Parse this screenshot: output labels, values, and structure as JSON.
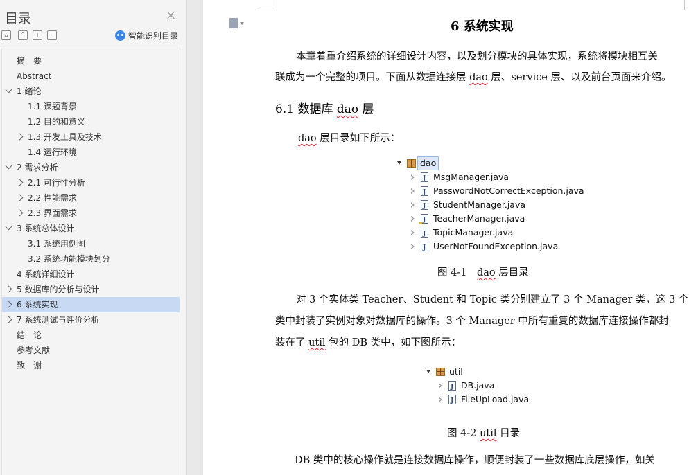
{
  "sidebar": {
    "title": "目录",
    "close_label": "close",
    "tools": [
      "expand-all",
      "collapse-up",
      "expand-plus",
      "collapse-minus"
    ],
    "smart_toc_label": "智能识别目录",
    "toc": [
      {
        "label": "摘　要",
        "level": 0,
        "chevron": "none",
        "active": false
      },
      {
        "label": "Abstract",
        "level": 0,
        "chevron": "none",
        "active": false
      },
      {
        "label": "1 绪论",
        "level": 0,
        "chevron": "down",
        "active": false
      },
      {
        "label": "1.1 课题背景",
        "level": 1,
        "chevron": "none",
        "active": false
      },
      {
        "label": "1.2 目的和意义",
        "level": 1,
        "chevron": "none",
        "active": false
      },
      {
        "label": "1.3 开发工具及技术",
        "level": 1,
        "chevron": "right",
        "active": false
      },
      {
        "label": "1.4 运行环境",
        "level": 1,
        "chevron": "none",
        "active": false
      },
      {
        "label": "2  需求分析",
        "level": 0,
        "chevron": "down",
        "active": false
      },
      {
        "label": "2.1 可行性分析",
        "level": 1,
        "chevron": "right",
        "active": false
      },
      {
        "label": "2.2 性能需求",
        "level": 1,
        "chevron": "right",
        "active": false
      },
      {
        "label": "2.3 界面需求",
        "level": 1,
        "chevron": "right",
        "active": false
      },
      {
        "label": "3  系统总体设计",
        "level": 0,
        "chevron": "down",
        "active": false
      },
      {
        "label": "3.1  系统用例图",
        "level": 1,
        "chevron": "none",
        "active": false
      },
      {
        "label": "3.2  系统功能模块划分",
        "level": 1,
        "chevron": "none",
        "active": false
      },
      {
        "label": "4 系统详细设计",
        "level": 0,
        "chevron": "none",
        "active": false
      },
      {
        "label": "5 数据库的分析与设计",
        "level": 0,
        "chevron": "right",
        "active": false
      },
      {
        "label": "6 系统实现",
        "level": 0,
        "chevron": "right",
        "active": true
      },
      {
        "label": "7 系统测试与评价分析",
        "level": 0,
        "chevron": "right",
        "active": false
      },
      {
        "label": "结　论",
        "level": 0,
        "chevron": "none",
        "active": false
      },
      {
        "label": "参考文献",
        "level": 0,
        "chevron": "none",
        "active": false
      },
      {
        "label": "致　谢",
        "level": 0,
        "chevron": "none",
        "active": false
      }
    ]
  },
  "doc": {
    "heading": "6 系统实现",
    "intro_line1": "本章着重介绍系统的详细设计内容，以及划分模块的具体实现，系统将模块相互关",
    "intro_line2_a": "联成为一个完整的项目。下面从数据连接层 ",
    "intro_line2_dao": "dao",
    "intro_line2_b": " 层、service 层、以及前台页面来介绍。",
    "section_heading_a": "6.1 数据库 ",
    "section_heading_dao": "dao",
    "section_heading_b": " 层",
    "dao_intro_dao": "dao",
    "dao_intro_rest": " 层目录如下所示：",
    "tree1": {
      "root": "dao",
      "files": [
        "MsgManager.java",
        "PasswordNotCorrectException.java",
        "StudentManager.java",
        "TeacherManager.java",
        "TopicManager.java",
        "UserNotFoundException.java"
      ]
    },
    "fig1_caption_a": "图 4-1　",
    "fig1_caption_dao": "dao",
    "fig1_caption_b": " 层目录",
    "para2_line1": "对 3 个实体类 Teacher、Student 和 Topic 类分别建立了 3 个 Manager 类，这 3 个 Manager",
    "para2_line2": "类中封装了实例对象对数据库的操作。3 个 Manager 中所有重复的数据库连接操作都封",
    "para2_line3_a": "装在了 ",
    "para2_line3_util": "util",
    "para2_line3_b": " 包的 DB 类中，如下图所示：",
    "tree2": {
      "root": "util",
      "files": [
        "DB.java",
        "FileUpLoad.java"
      ]
    },
    "fig2_caption_a": "图 4-2 ",
    "fig2_caption_util": "util",
    "fig2_caption_b": " 目录",
    "para3_line1": "DB 类中的核心操作就是连接数据库操作，顺便封装了一些数据库底层操作，如关"
  }
}
